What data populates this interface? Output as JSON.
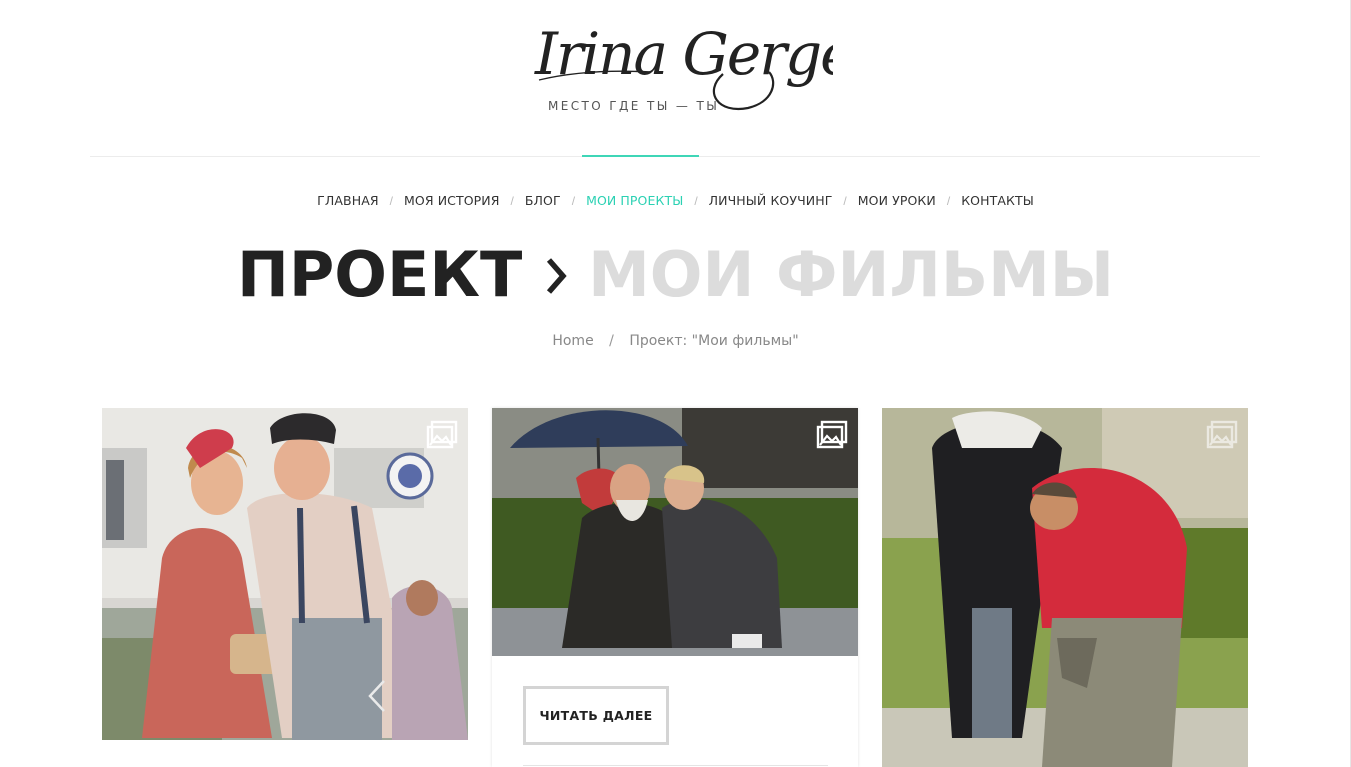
{
  "site": {
    "logo_text": "Irina Gergel",
    "tagline": "МЕСТО ГДЕ ТЫ — ТЫ"
  },
  "nav": {
    "items": [
      {
        "label": "ГЛАВНАЯ",
        "active": false
      },
      {
        "label": "МОЯ ИСТОРИЯ",
        "active": false
      },
      {
        "label": "БЛОГ",
        "active": false
      },
      {
        "label": "МОИ ПРОЕКТЫ",
        "active": true
      },
      {
        "label": "ЛИЧНЫЙ КОУЧИНГ",
        "active": false
      },
      {
        "label": "МОИ УРОКИ",
        "active": false
      },
      {
        "label": "КОНТАКТЫ",
        "active": false
      }
    ],
    "separator": "/"
  },
  "page_title": {
    "prefix": "ПРОЕКТ",
    "arrow_icon": "chevron-right-icon",
    "suffix": "МОИ ФИЛЬМЫ"
  },
  "breadcrumb": {
    "home": "Home",
    "separator": "/",
    "current": "Проект: \"Мои фильмы\""
  },
  "cards": [
    {
      "icon": "gallery-icon",
      "has_slider_arrow": true
    },
    {
      "icon": "gallery-icon",
      "read_more_label": "ЧИТАТЬ ДАЛЕЕ"
    },
    {
      "icon": "gallery-icon"
    }
  ],
  "colors": {
    "accent": "#2bd1b3",
    "title_dark": "#222222",
    "title_light": "#dcdcdc"
  }
}
